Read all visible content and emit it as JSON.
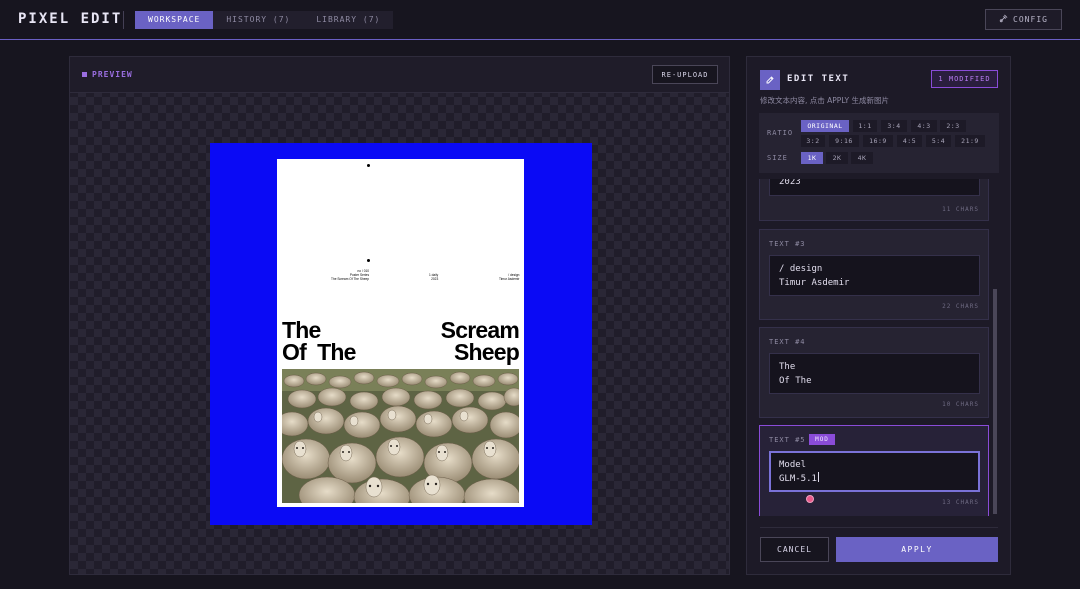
{
  "app": {
    "brand": "PIXEL EDIT",
    "tabs": [
      {
        "label": "WORKSPACE",
        "active": true
      },
      {
        "label": "HISTORY (7)",
        "active": false
      },
      {
        "label": "LIBRARY (7)",
        "active": false
      }
    ],
    "config_label": "CONFIG",
    "accent_color": "#6a62c4",
    "modified_color": "#8a4cd8"
  },
  "preview": {
    "title": "PREVIEW",
    "reupload_label": "RE-UPLOAD",
    "canvas_color": "#0a0af5",
    "poster": {
      "meta_left": "no / 010\nPoster Series\nThe Scream Of The Sheep",
      "meta_mid": "1 daily\n2023",
      "meta_right": "/ design\nTimur Asdemir",
      "headline_left": "The\nOf  The",
      "headline_right": "Scream\nSheep",
      "photo_icon": "sheep-flock-image"
    }
  },
  "editor": {
    "title": "EDIT TEXT",
    "modified_badge": "1 MODIFIED",
    "subtitle": "修改文本内容, 点击 APPLY 生成新图片",
    "ratio_label": "RATIO",
    "ratios": [
      {
        "label": "ORIGINAL",
        "selected": true
      },
      {
        "label": "1:1",
        "selected": false
      },
      {
        "label": "3:4",
        "selected": false
      },
      {
        "label": "4:3",
        "selected": false
      },
      {
        "label": "2:3",
        "selected": false
      },
      {
        "label": "3:2",
        "selected": false
      },
      {
        "label": "9:16",
        "selected": false
      },
      {
        "label": "16:9",
        "selected": false
      },
      {
        "label": "4:5",
        "selected": false
      },
      {
        "label": "5:4",
        "selected": false
      },
      {
        "label": "21:9",
        "selected": false
      }
    ],
    "size_label": "SIZE",
    "sizes": [
      {
        "label": "1K",
        "selected": true
      },
      {
        "label": "2K",
        "selected": false
      },
      {
        "label": "4K",
        "selected": false
      }
    ],
    "texts": [
      {
        "label": "",
        "value": "2023",
        "chars": "11 CHARS",
        "modified": false
      },
      {
        "label": "TEXT #3",
        "value": "/ design\nTimur Asdemir",
        "chars": "22 CHARS",
        "modified": false
      },
      {
        "label": "TEXT #4",
        "value": "The\nOf The",
        "chars": "10 CHARS",
        "modified": false
      },
      {
        "label": "TEXT #5",
        "value": "Model\nGLM-5.1",
        "chars": "13 CHARS",
        "modified": true,
        "tag": "MOD"
      }
    ],
    "cancel_label": "CANCEL",
    "apply_label": "APPLY"
  }
}
